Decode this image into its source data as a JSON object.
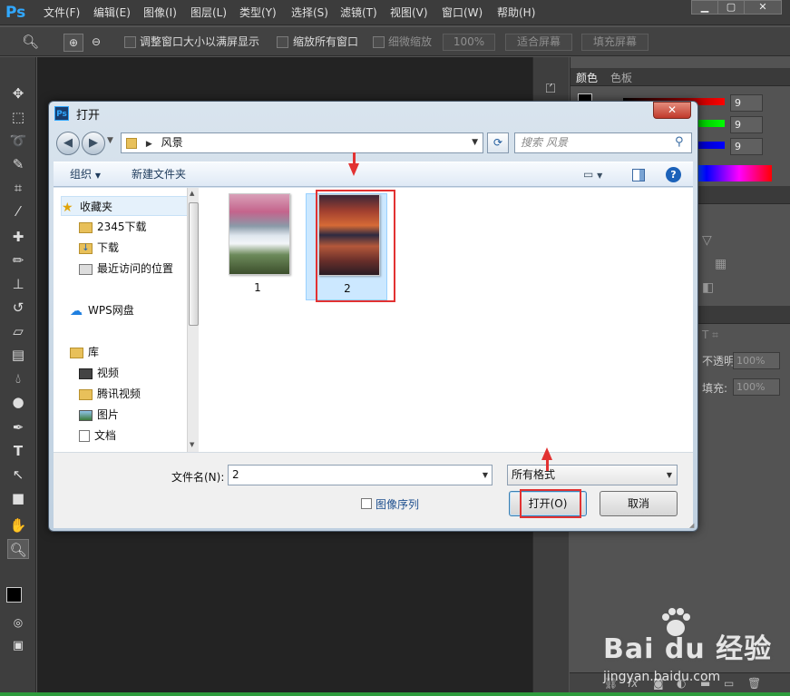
{
  "app": {
    "logo": "Ps",
    "menu": [
      "文件(F)",
      "编辑(E)",
      "图像(I)",
      "图层(L)",
      "类型(Y)",
      "选择(S)",
      "滤镜(T)",
      "视图(V)",
      "窗口(W)",
      "帮助(H)"
    ],
    "window_buttons": [
      "▁",
      "▢",
      "✕"
    ]
  },
  "options": {
    "resize_windows": "调整窗口大小以满屏显示",
    "zoom_all": "缩放所有窗口",
    "scrubby_zoom": "细微缩放",
    "zoom_percent": "100%",
    "fit_screen": "适合屏幕",
    "fill_screen": "填充屏幕"
  },
  "right_panel": {
    "tabs": [
      "颜色",
      "色板"
    ],
    "color_values": [
      "9",
      "9",
      "9"
    ],
    "opacity_label": "不透明度:",
    "opacity_value": "100%",
    "fill_label": "填充:",
    "fill_value": "100%"
  },
  "dialog": {
    "title": "打开",
    "close": "✕",
    "address": "风景",
    "search_placeholder": "搜索 风景",
    "organize": "组织",
    "new_folder": "新建文件夹",
    "help": "?",
    "nav": {
      "favorites": "收藏夹",
      "fav_items": [
        "2345下载",
        "下载",
        "最近访问的位置"
      ],
      "wps_cloud": "WPS网盘",
      "library": "库",
      "lib_items": [
        "视频",
        "腾讯视频",
        "图片",
        "文档"
      ]
    },
    "files": [
      {
        "name": "1"
      },
      {
        "name": "2"
      }
    ],
    "filename_label": "文件名(N):",
    "filename_value": "2",
    "filetype_value": "所有格式",
    "image_sequence": "图像序列",
    "open_button": "打开(O)",
    "cancel_button": "取消"
  },
  "watermark": {
    "brand": "Bai du 经验",
    "url": "jingyan.baidu.com"
  },
  "colors": {
    "highlight": "#e23232",
    "selection": "#cce8ff",
    "ps_blue": "#31a8ff"
  }
}
